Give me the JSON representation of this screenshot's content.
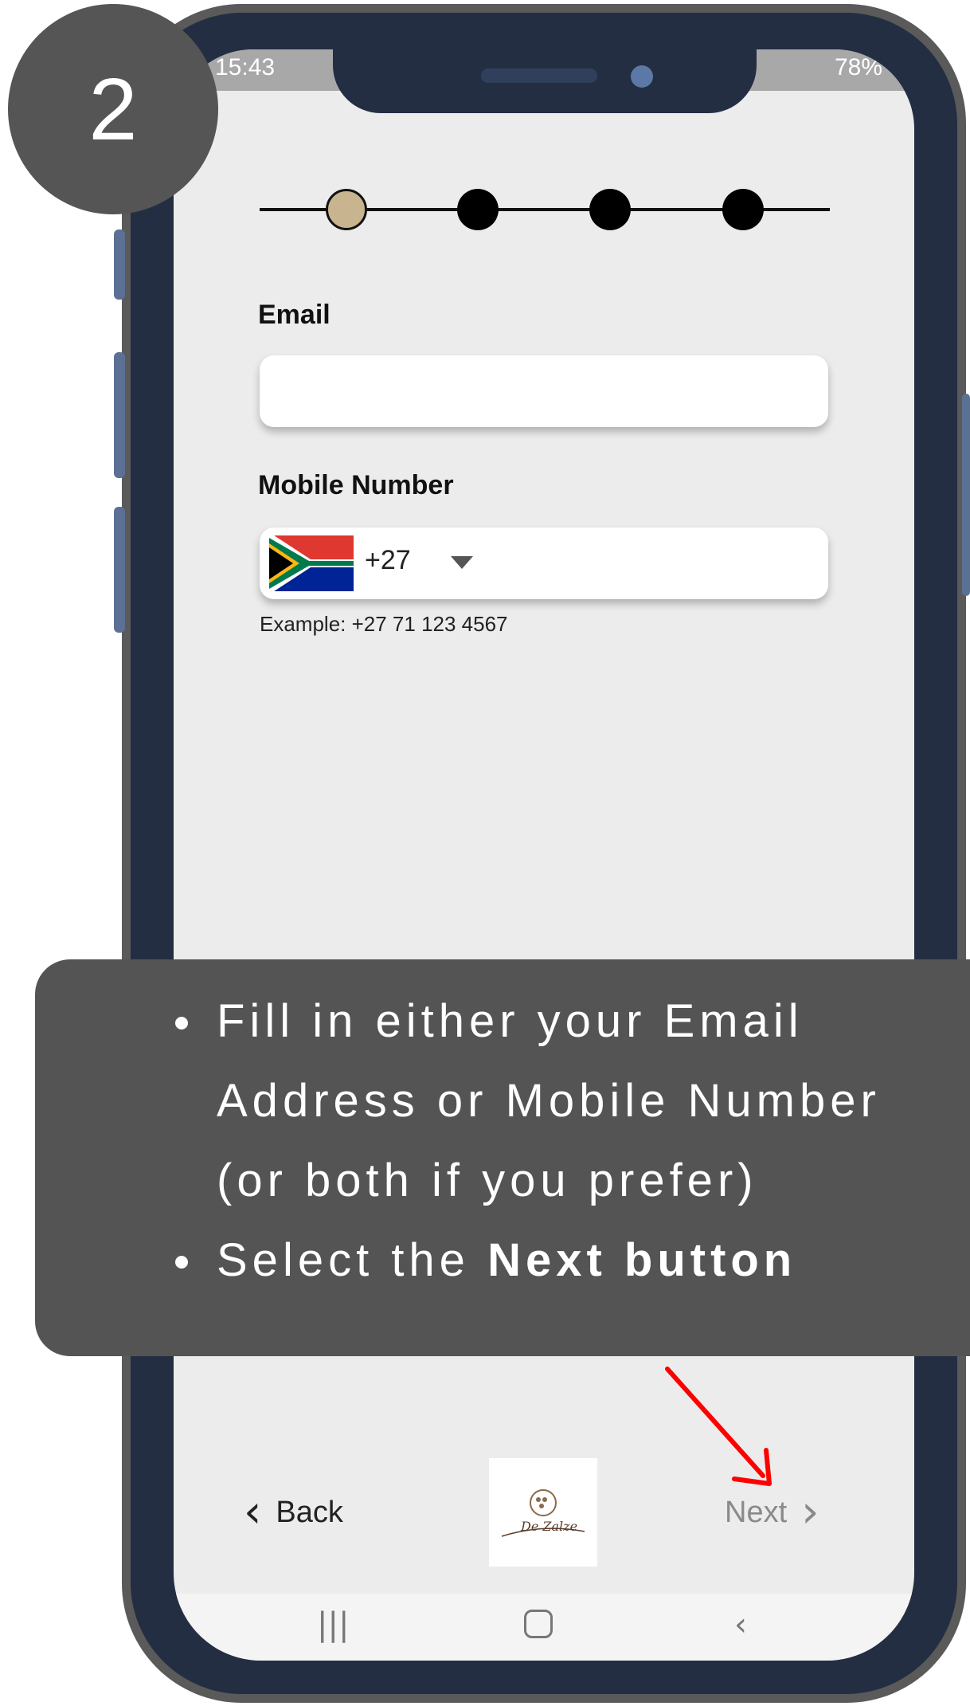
{
  "badge": {
    "number": "2"
  },
  "status_bar": {
    "time": "15:43",
    "battery": "78%"
  },
  "stepper": {
    "total_steps": 4,
    "active_step": 1,
    "active_color": "#c8b48e"
  },
  "form": {
    "email_label": "Email",
    "email_value": "",
    "mobile_label": "Mobile Number",
    "country_code": "+27",
    "mobile_value": "",
    "mobile_hint": "Example: +27 71 123 4567"
  },
  "nav": {
    "back_label": "Back",
    "next_label": "Next",
    "logo_text": "De Zalze"
  },
  "instructions": {
    "bullet1": "Fill in either your Email Address or Mobile Number (or both if you prefer)",
    "bullet2_prefix": "Select the ",
    "bullet2_bold": "Next button"
  },
  "colors": {
    "panel": "#545454",
    "phone_frame": "#232e42",
    "arrow": "#ff0000"
  }
}
